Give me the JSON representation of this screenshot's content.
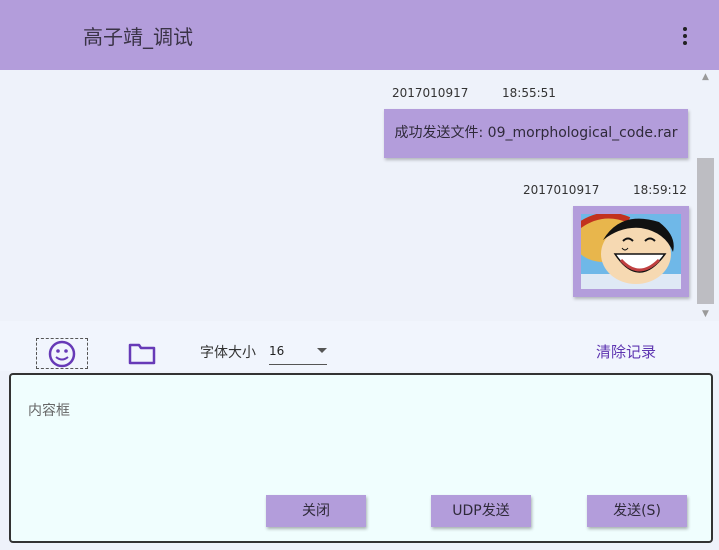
{
  "header": {
    "title": "高子靖_调试",
    "menu_icon": "more-vert-icon"
  },
  "messages": [
    {
      "date": "2017010917",
      "time": "18:55:51",
      "type": "file",
      "text": "成功发送文件: 09_morphological_code.rar"
    },
    {
      "date": "2017010917",
      "time": "18:59:12",
      "type": "image",
      "image": "luffy-laughing-picture"
    }
  ],
  "toolbar": {
    "emoji_icon": "smiley-icon",
    "folder_icon": "folder-icon",
    "font_size_label": "字体大小",
    "font_size_value": "16",
    "clear_label": "清除记录"
  },
  "input": {
    "placeholder": "内容框"
  },
  "buttons": {
    "close": "关闭",
    "udp_send": "UDP发送",
    "send": "发送(S)"
  },
  "colors": {
    "accent": "#b39ddb",
    "link": "#5e35b1",
    "input_bg": "#f0fefe"
  }
}
